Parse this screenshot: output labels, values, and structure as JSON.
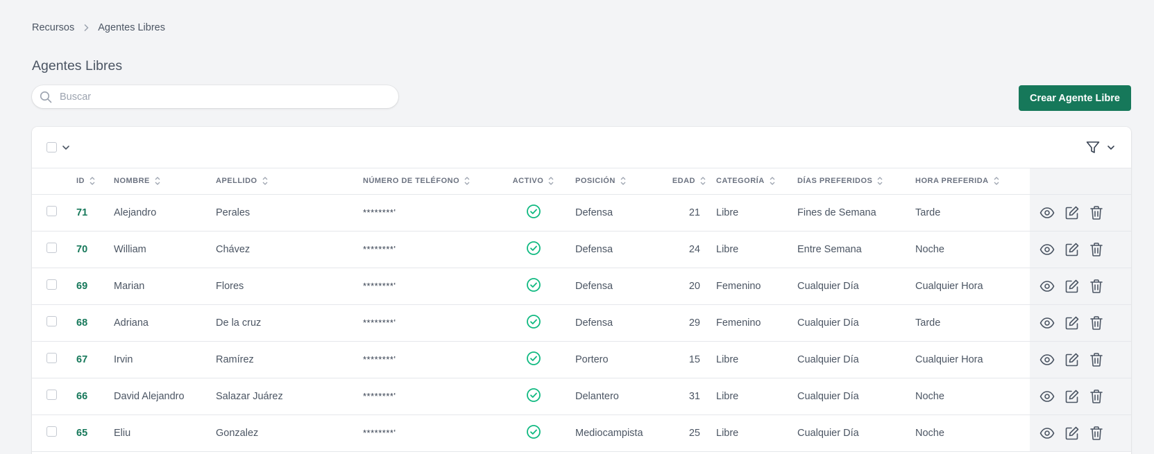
{
  "breadcrumb": {
    "parent": "Recursos",
    "current": "Agentes Libres"
  },
  "page": {
    "title": "Agentes Libres"
  },
  "search": {
    "placeholder": "Buscar"
  },
  "actions": {
    "create_label": "Crear Agente Libre"
  },
  "table": {
    "columns": [
      "ID",
      "NOMBRE",
      "APELLIDO",
      "NÚMERO DE TELÉFONO",
      "ACTIVO",
      "POSICIÓN",
      "EDAD",
      "CATEGORÍA",
      "DÍAS PREFERIDOS",
      "HORA PREFERIDA"
    ],
    "rows": [
      {
        "id": "71",
        "nombre": "Alejandro",
        "apellido": "Perales",
        "telefono": "********'",
        "activo": true,
        "posicion": "Defensa",
        "edad": "21",
        "categoria": "Libre",
        "dias": "Fines de Semana",
        "hora": "Tarde"
      },
      {
        "id": "70",
        "nombre": "William",
        "apellido": "Chávez",
        "telefono": "********'",
        "activo": true,
        "posicion": "Defensa",
        "edad": "24",
        "categoria": "Libre",
        "dias": "Entre Semana",
        "hora": "Noche"
      },
      {
        "id": "69",
        "nombre": "Marian",
        "apellido": "Flores",
        "telefono": "********'",
        "activo": true,
        "posicion": "Defensa",
        "edad": "20",
        "categoria": "Femenino",
        "dias": "Cualquier Día",
        "hora": "Cualquier Hora"
      },
      {
        "id": "68",
        "nombre": "Adriana",
        "apellido": "De la cruz",
        "telefono": "********'",
        "activo": true,
        "posicion": "Defensa",
        "edad": "29",
        "categoria": "Femenino",
        "dias": "Cualquier Día",
        "hora": "Tarde"
      },
      {
        "id": "67",
        "nombre": "Irvin",
        "apellido": "Ramírez",
        "telefono": "********'",
        "activo": true,
        "posicion": "Portero",
        "edad": "15",
        "categoria": "Libre",
        "dias": "Cualquier Día",
        "hora": "Cualquier Hora"
      },
      {
        "id": "66",
        "nombre": "David Alejandro",
        "apellido": "Salazar Juárez",
        "telefono": "********'",
        "activo": true,
        "posicion": "Delantero",
        "edad": "31",
        "categoria": "Libre",
        "dias": "Cualquier Día",
        "hora": "Noche"
      },
      {
        "id": "65",
        "nombre": "Eliu",
        "apellido": "Gonzalez",
        "telefono": "********'",
        "activo": true,
        "posicion": "Mediocampista",
        "edad": "25",
        "categoria": "Libre",
        "dias": "Cualquier Día",
        "hora": "Noche"
      }
    ]
  },
  "colors": {
    "accent": "#16785a",
    "active_check": "#10b981",
    "background": "#f3f4f6"
  },
  "icons": {
    "search": "search-icon",
    "filter": "filter-icon",
    "view": "eye-icon",
    "edit": "edit-icon",
    "delete": "trash-icon",
    "active": "check-circle-icon"
  }
}
